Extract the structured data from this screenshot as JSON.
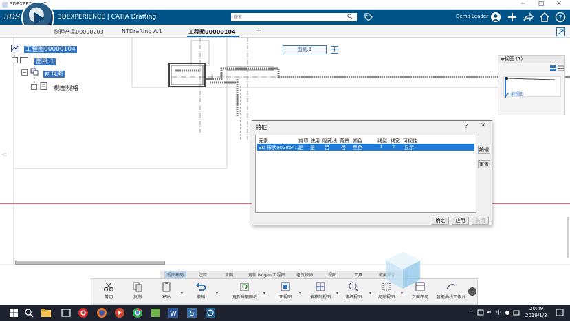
{
  "window": {
    "title": "3DEXPERIENCE",
    "minimize": "─",
    "maximize": "□",
    "close": "✕"
  },
  "appbar": {
    "brand": "3DEXPERIENCE | CATIA Drafting",
    "search_placeholder": "搜索",
    "user": "Demo Leader",
    "icons": [
      "search-icon",
      "tag-icon",
      "user-avatar-icon",
      "add-icon",
      "share-icon",
      "home-icon",
      "help-icon"
    ]
  },
  "tabs": [
    {
      "label": "物理产品00000203",
      "active": false
    },
    {
      "label": "NTDrafting A.1",
      "active": false
    },
    {
      "label": "工程图00000104",
      "active": true
    }
  ],
  "tab_add": "+",
  "tree": {
    "root": "工程图00000104",
    "sheet": "图纸.1",
    "view": "前视图",
    "spec": "视图规格",
    "expand": "+",
    "collapse": "−"
  },
  "canvas": {
    "sheet_tag": "图纸.1",
    "sheet_add": "+"
  },
  "view_panel": {
    "title": "视图 (1)",
    "item": "前视图"
  },
  "dialog": {
    "title": "特征",
    "help": "?",
    "close": "✕",
    "columns": [
      "元素",
      "剪切",
      "使用",
      "隐藏线",
      "背景",
      "颜色",
      "线型",
      "线宽",
      "可视性"
    ],
    "rows": [
      [
        "3D 形状002854...",
        "是",
        "是",
        "否",
        "否",
        "黑色",
        "1",
        "2",
        "显示"
      ]
    ],
    "side_buttons": [
      "编辑",
      "重置"
    ],
    "buttons": {
      "ok": "确定",
      "apply": "应用",
      "close": "关闭"
    }
  },
  "action_tabs": [
    {
      "label": "视图布局",
      "active": true
    },
    {
      "label": "注释",
      "active": false
    },
    {
      "label": "草图",
      "active": false
    },
    {
      "label": "更新 Isogen 工程图",
      "active": false
    },
    {
      "label": "电气修饰",
      "active": false
    },
    {
      "label": "视图",
      "active": false
    },
    {
      "label": "工具",
      "active": false
    },
    {
      "label": "截屏操作",
      "active": false
    }
  ],
  "actions": [
    {
      "label": "剪切",
      "icon": "scissors-icon"
    },
    {
      "label": "复制",
      "icon": "copy-icon"
    },
    {
      "label": "粘贴",
      "icon": "paste-icon"
    },
    {
      "label": "撤销",
      "icon": "undo-icon"
    },
    {
      "label": "更新当前图纸",
      "icon": "update-icon"
    },
    {
      "label": "正视图",
      "icon": "front-view-icon"
    },
    {
      "label": "偏移剖视图",
      "icon": "offset-section-icon"
    },
    {
      "label": "详细视图",
      "icon": "detail-view-icon"
    },
    {
      "label": "局部视图",
      "icon": "clipping-view-icon"
    },
    {
      "label": "页面布局",
      "icon": "page-layout-icon"
    },
    {
      "label": "智能曲线工作台",
      "icon": "workbench-icon"
    }
  ],
  "taskbar": {
    "ime1": "中",
    "time": "20:49",
    "date": "2019/1/3",
    "icons": [
      "windows-icon",
      "search-icon",
      "file-explorer-icon",
      "netease-music-icon",
      "firefox-icon",
      "chrome-icon",
      "maps-icon",
      "word-icon",
      "solidworks-icon",
      "3dexperience-icon"
    ]
  },
  "colors": {
    "appbar": "#005386",
    "selection": "#2f73c9",
    "row_selected": "#1e7ad8",
    "redline": "#e06b6b"
  }
}
